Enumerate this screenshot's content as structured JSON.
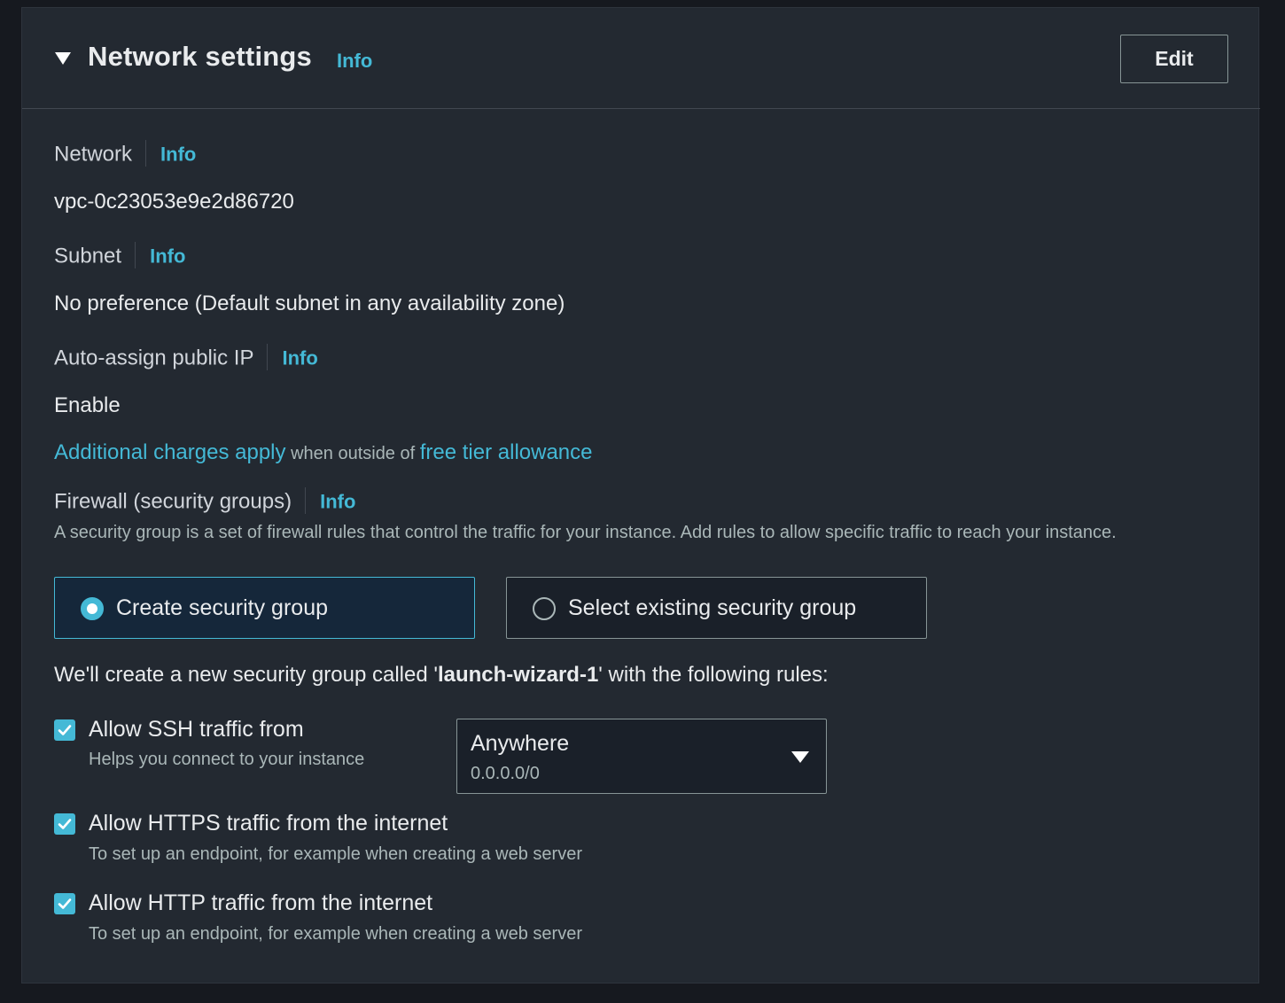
{
  "header": {
    "title": "Network settings",
    "info": "Info",
    "edit_label": "Edit"
  },
  "network": {
    "label": "Network",
    "info": "Info",
    "value": "vpc-0c23053e9e2d86720"
  },
  "subnet": {
    "label": "Subnet",
    "info": "Info",
    "value": "No preference (Default subnet in any availability zone)"
  },
  "public_ip": {
    "label": "Auto-assign public IP",
    "info": "Info",
    "value": "Enable"
  },
  "charges": {
    "link1": "Additional charges apply",
    "middle": " when outside of ",
    "link2": "free tier allowance"
  },
  "firewall": {
    "label": "Firewall (security groups)",
    "info": "Info",
    "description": "A security group is a set of firewall rules that control the traffic for your instance. Add rules to allow specific traffic to reach your instance.",
    "options": [
      {
        "label": "Create security group",
        "selected": true
      },
      {
        "label": "Select existing security group",
        "selected": false
      }
    ],
    "intro_prefix": "We'll create a new security group called '",
    "group_name": "launch-wizard-1",
    "intro_suffix": "' with the following rules:"
  },
  "rules": [
    {
      "label": "Allow SSH traffic from",
      "description": "Helps you connect to your instance",
      "checked": true
    },
    {
      "label": "Allow HTTPS traffic from the internet",
      "description": "To set up an endpoint, for example when creating a web server",
      "checked": true
    },
    {
      "label": "Allow HTTP traffic from the internet",
      "description": "To set up an endpoint, for example when creating a web server",
      "checked": true
    }
  ],
  "ssh_source": {
    "selected": "Anywhere",
    "sub": "0.0.0.0/0"
  },
  "colors": {
    "accent": "#44b9d6",
    "panel_bg": "#232931",
    "page_bg": "#16191f"
  }
}
